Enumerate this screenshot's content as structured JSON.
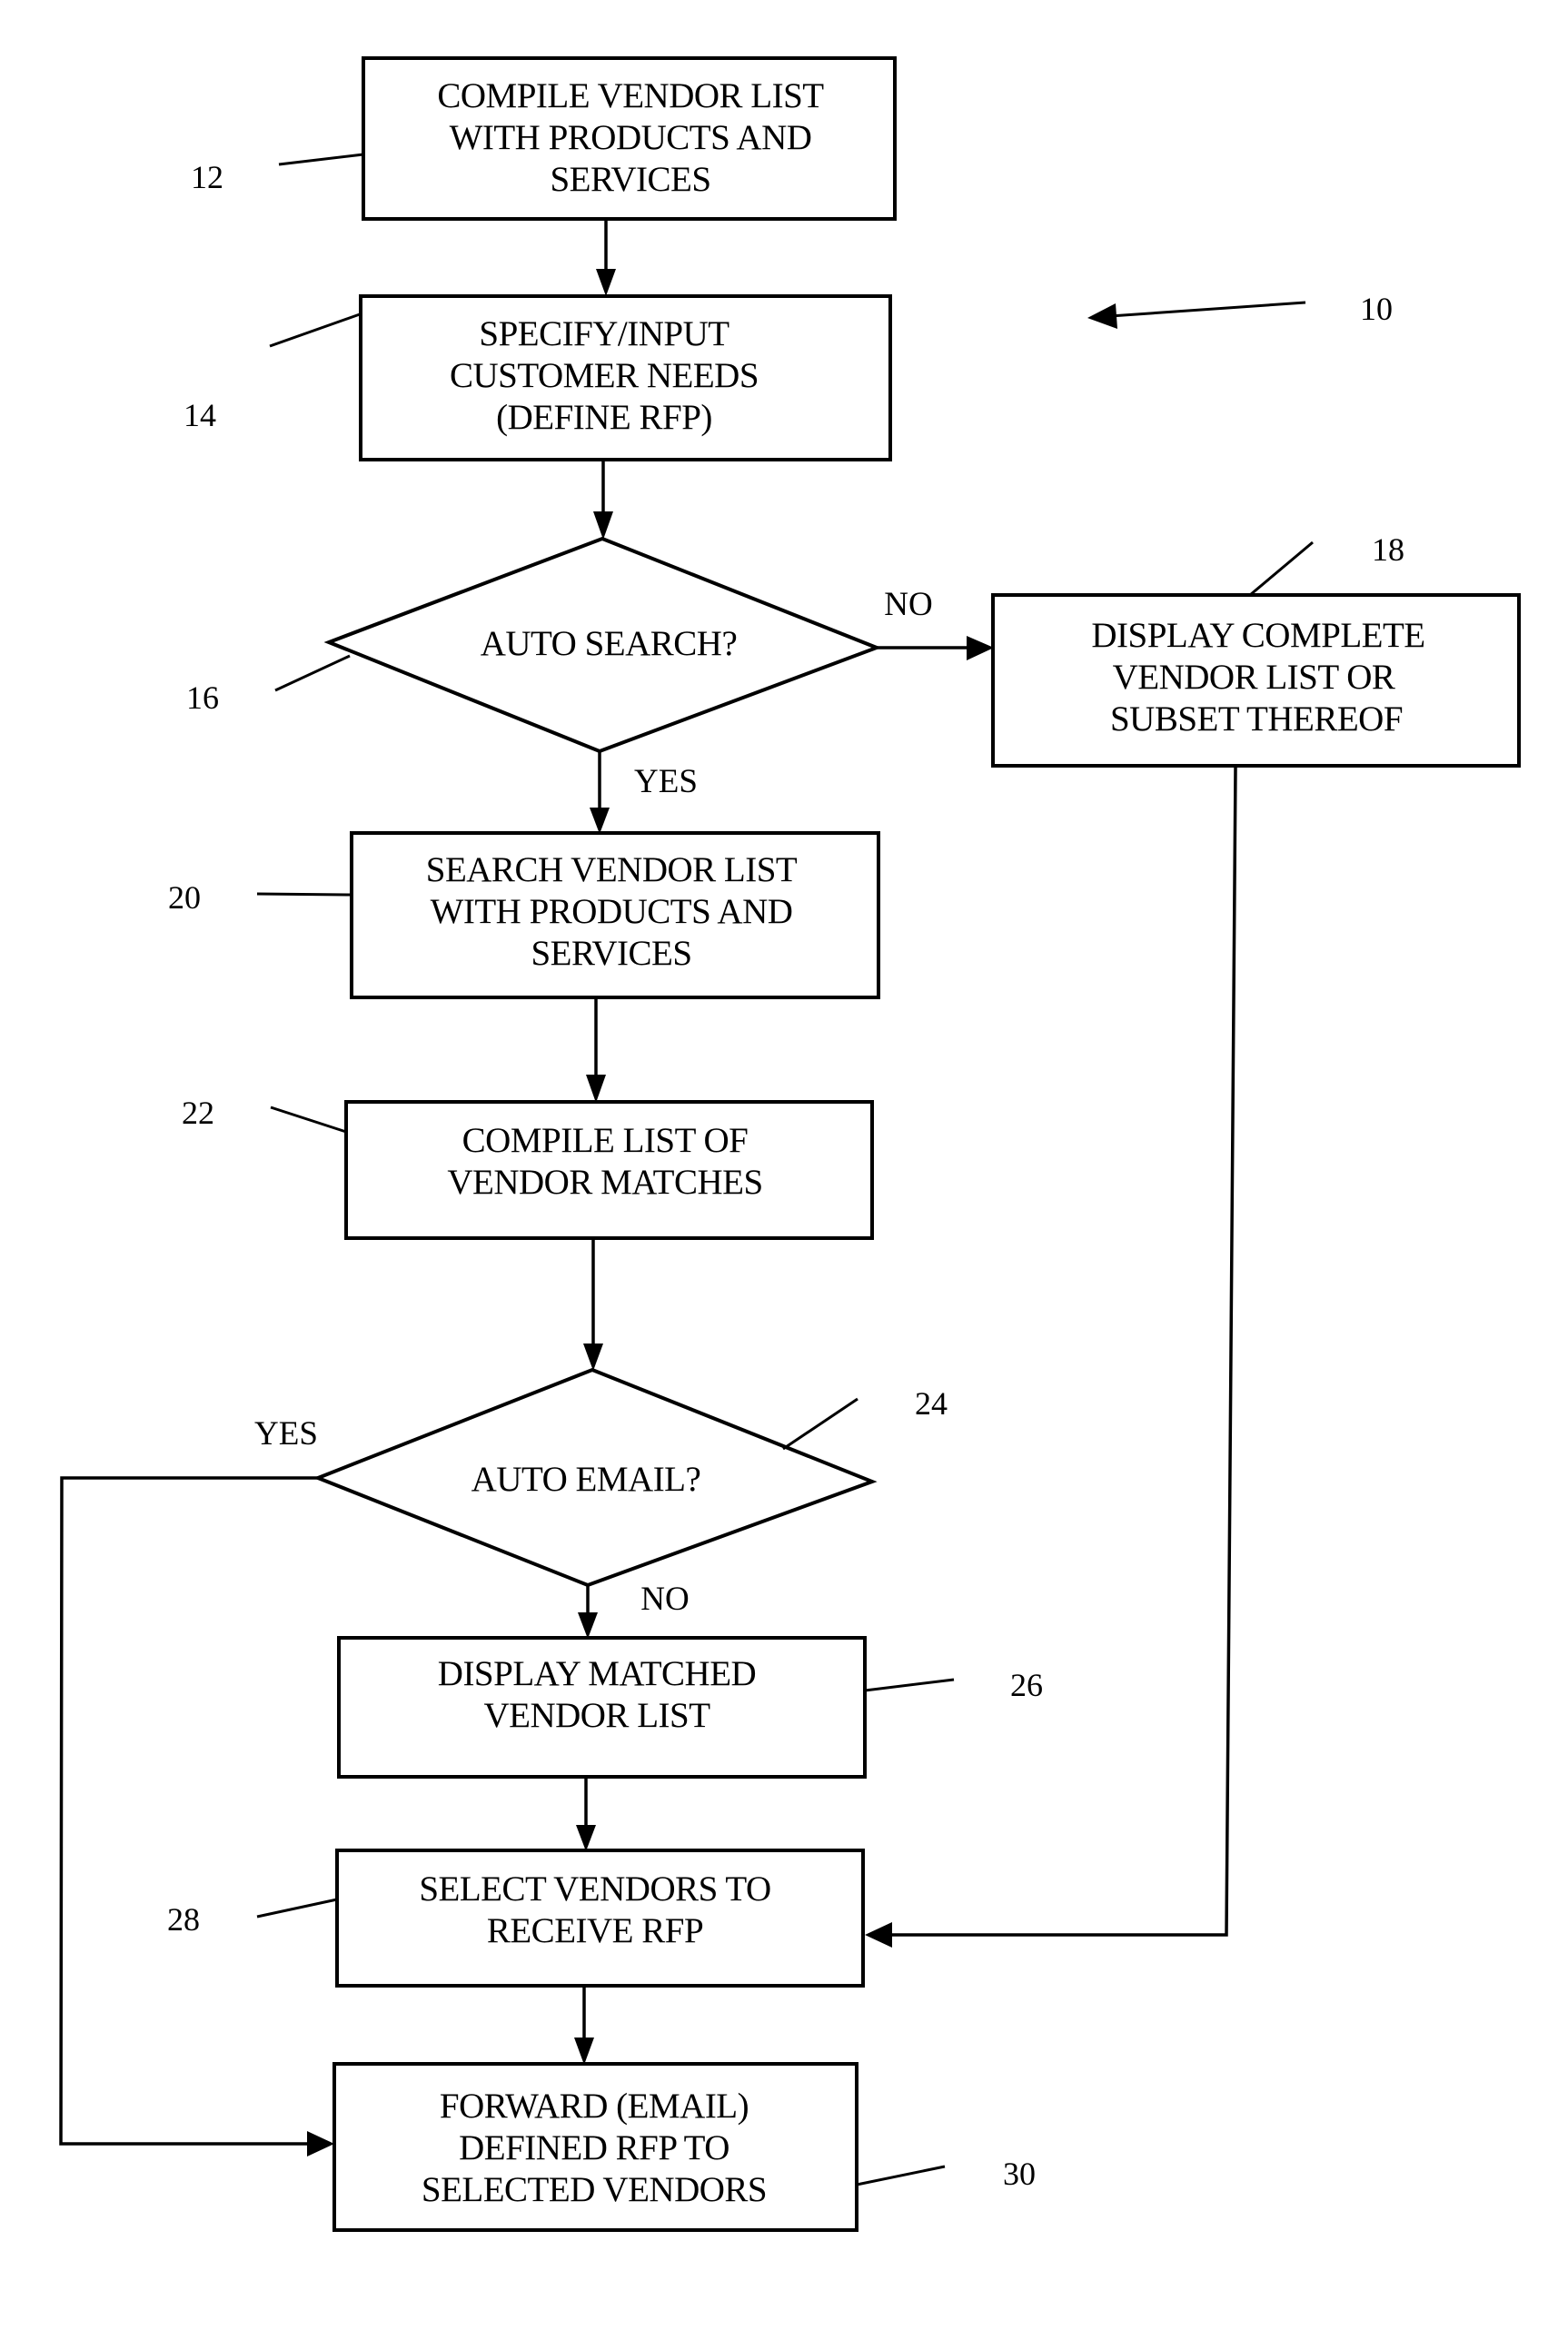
{
  "figure": {
    "reference": "10",
    "nodes": {
      "n12": {
        "ref": "12",
        "type": "process",
        "lines": [
          "COMPILE VENDOR LIST",
          "WITH PRODUCTS AND",
          "SERVICES"
        ]
      },
      "n14": {
        "ref": "14",
        "type": "process",
        "lines": [
          "SPECIFY/INPUT",
          "CUSTOMER NEEDS",
          "(DEFINE RFP)"
        ]
      },
      "n16": {
        "ref": "16",
        "type": "decision",
        "lines": [
          "AUTO SEARCH?"
        ]
      },
      "n18": {
        "ref": "18",
        "type": "process",
        "lines": [
          "DISPLAY COMPLETE",
          "VENDOR LIST OR",
          "SUBSET THEREOF"
        ]
      },
      "n20": {
        "ref": "20",
        "type": "process",
        "lines": [
          "SEARCH VENDOR LIST",
          "WITH PRODUCTS AND",
          "SERVICES"
        ]
      },
      "n22": {
        "ref": "22",
        "type": "process",
        "lines": [
          "COMPILE LIST OF",
          "VENDOR MATCHES"
        ]
      },
      "n24": {
        "ref": "24",
        "type": "decision",
        "lines": [
          "AUTO EMAIL?"
        ]
      },
      "n26": {
        "ref": "26",
        "type": "process",
        "lines": [
          "DISPLAY MATCHED",
          "VENDOR LIST"
        ]
      },
      "n28": {
        "ref": "28",
        "type": "process",
        "lines": [
          "SELECT VENDORS TO",
          "RECEIVE RFP"
        ]
      },
      "n30": {
        "ref": "30",
        "type": "process",
        "lines": [
          "FORWARD (EMAIL)",
          "DEFINED RFP TO",
          "SELECTED VENDORS"
        ]
      }
    },
    "edges": [
      {
        "from": "12",
        "to": "14",
        "label": ""
      },
      {
        "from": "14",
        "to": "16",
        "label": ""
      },
      {
        "from": "16",
        "to": "18",
        "label": "NO"
      },
      {
        "from": "16",
        "to": "20",
        "label": "YES"
      },
      {
        "from": "18",
        "to": "28",
        "label": ""
      },
      {
        "from": "20",
        "to": "22",
        "label": ""
      },
      {
        "from": "22",
        "to": "24",
        "label": ""
      },
      {
        "from": "24",
        "to": "30",
        "label": "YES"
      },
      {
        "from": "24",
        "to": "26",
        "label": "NO"
      },
      {
        "from": "26",
        "to": "28",
        "label": ""
      },
      {
        "from": "28",
        "to": "30",
        "label": ""
      }
    ],
    "edge_labels": {
      "n16_no": "NO",
      "n16_yes": "YES",
      "n24_yes": "YES",
      "n24_no": "NO"
    }
  }
}
